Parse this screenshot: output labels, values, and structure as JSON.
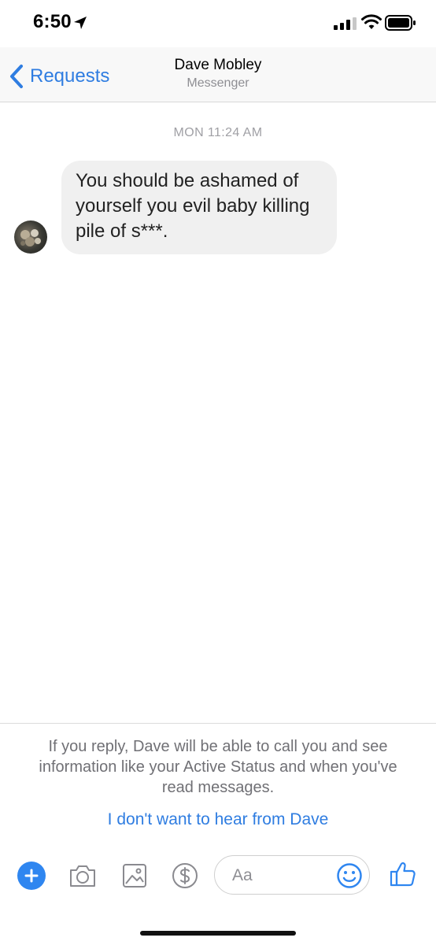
{
  "status_bar": {
    "time": "6:50",
    "icons": [
      "location-arrow-icon",
      "cellular-signal-icon",
      "wifi-icon",
      "battery-icon"
    ]
  },
  "nav": {
    "back_label": "Requests",
    "title": "Dave Mobley",
    "subtitle": "Messenger",
    "back_icon": "chevron-left-icon"
  },
  "conversation": {
    "timestamp": "MON 11:24 AM",
    "messages": [
      {
        "text": "You should be ashamed of yourself you evil baby killing pile of s***.",
        "direction": "incoming"
      }
    ]
  },
  "request_notice": {
    "text": "If you reply, Dave will be able to call you and see information like your Active Status and when you've read messages.",
    "block_link": "I don't want to hear from Dave"
  },
  "composer": {
    "placeholder": "Aa",
    "icons": [
      "plus-icon",
      "camera-icon",
      "gallery-icon",
      "dollar-icon",
      "emoji-icon",
      "thumbs-up-icon"
    ]
  },
  "colors": {
    "accent": "#2f7de1",
    "bubble_bg": "#f0f0f0",
    "muted_text": "#8e8e93"
  }
}
